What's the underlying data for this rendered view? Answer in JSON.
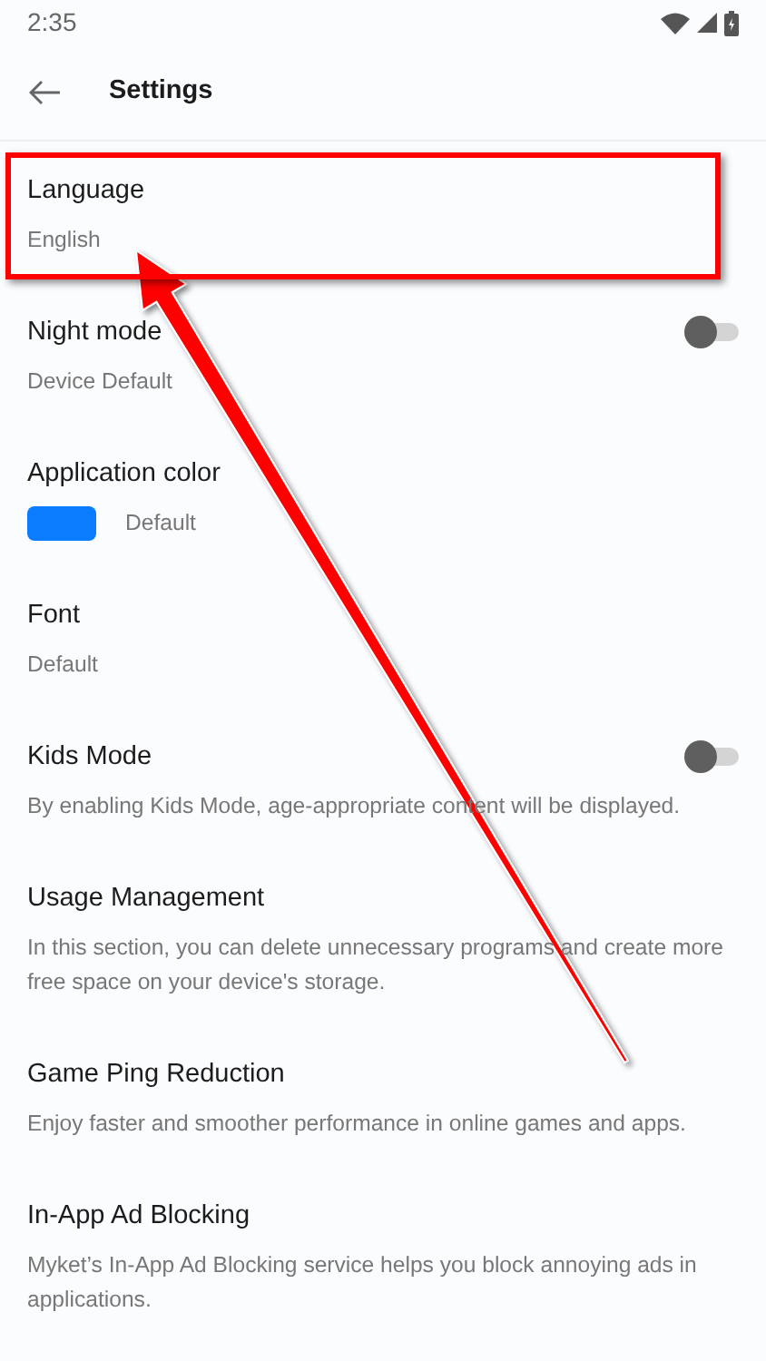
{
  "status_bar": {
    "time": "2:35"
  },
  "toolbar": {
    "title": "Settings"
  },
  "items": [
    {
      "kind": "value",
      "title": "Language",
      "subtitle": "English",
      "highlighted": true
    },
    {
      "kind": "toggle",
      "title": "Night mode",
      "subtitle": "Device Default",
      "on": false,
      "highlighted": false
    },
    {
      "kind": "color",
      "title": "Application color",
      "subtitle": "Default",
      "color": "#0a7cff",
      "highlighted": false
    },
    {
      "kind": "value",
      "title": "Font",
      "subtitle": "Default",
      "highlighted": false
    },
    {
      "kind": "toggle",
      "title": "Kids Mode",
      "subtitle": "By enabling Kids Mode, age-appropriate content will be displayed.",
      "on": false,
      "highlighted": false
    },
    {
      "kind": "value",
      "title": "Usage Management",
      "subtitle": "In this section, you can delete unnecessary programs and create more free space on your device's storage.",
      "highlighted": false
    },
    {
      "kind": "value",
      "title": "Game Ping Reduction",
      "subtitle": "Enjoy faster and smoother performance in online games and apps.",
      "highlighted": false
    },
    {
      "kind": "value",
      "title": "In-App Ad Blocking",
      "subtitle": "Myket’s In-App Ad Blocking service helps you block annoying ads in applications.",
      "highlighted": false
    }
  ]
}
